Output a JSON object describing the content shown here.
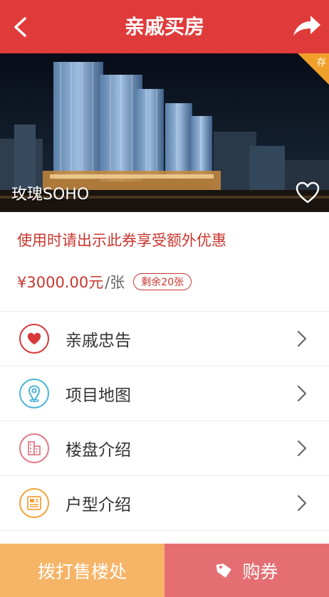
{
  "header": {
    "title": "亲戚买房",
    "back_icon": "chevron-left-icon",
    "share_icon": "share-arrow-icon",
    "color": "#e03b3b"
  },
  "banner": {
    "project_name": "玫瑰SOHO",
    "ribbon_text": "存",
    "favorite_icon": "heart-outline-icon"
  },
  "offer": {
    "notice": "使用时请出示此券享受额外优惠",
    "price": "¥3000.00元",
    "unit": "/张",
    "remaining": "剩余20张"
  },
  "menu": [
    {
      "label": "亲戚忠告",
      "icon": "heart-icon",
      "color": "#d9393c"
    },
    {
      "label": "项目地图",
      "icon": "map-pin-icon",
      "color": "#4ab5d8"
    },
    {
      "label": "楼盘介绍",
      "icon": "building-icon",
      "color": "#e27a86"
    },
    {
      "label": "户型介绍",
      "icon": "floorplan-doc-icon",
      "color": "#f0a339"
    }
  ],
  "actions": {
    "call_label": "拨打售楼处",
    "buy_label": "购券",
    "buy_icon": "tag-icon",
    "call_color": "#f6b466",
    "buy_color": "#e56e72"
  }
}
